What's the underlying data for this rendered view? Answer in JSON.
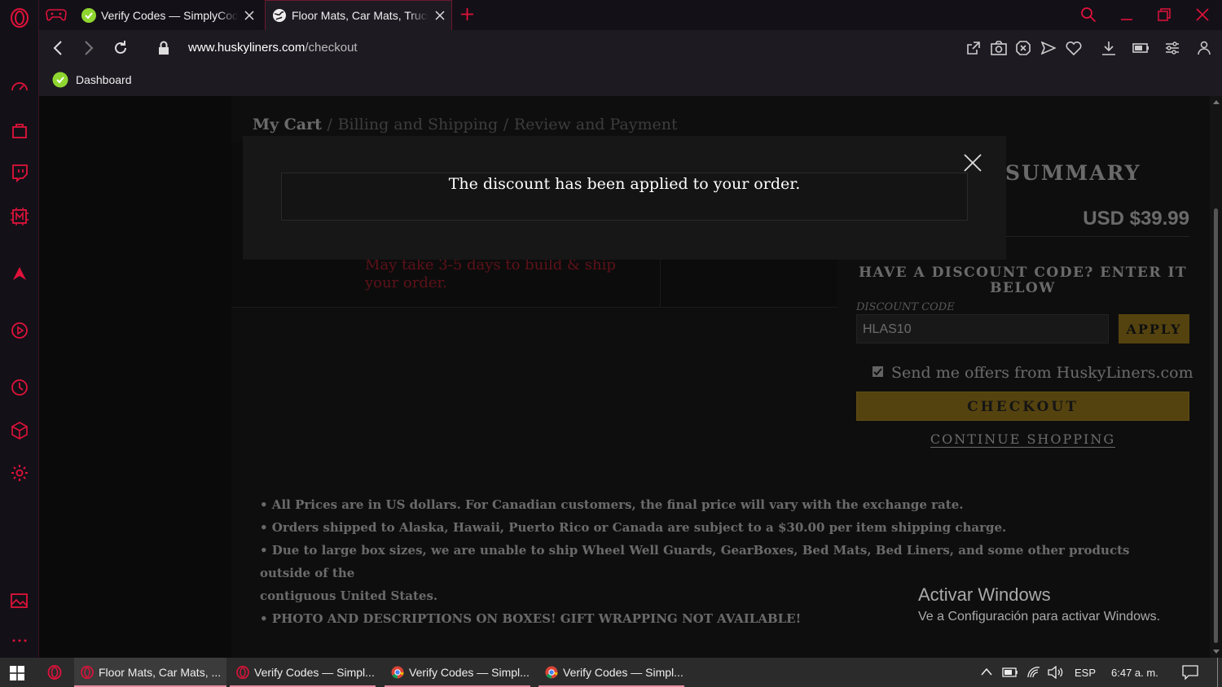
{
  "browser": {
    "tabs": [
      {
        "title": "Verify Codes — SimplyCodes",
        "active": false
      },
      {
        "title": "Floor Mats, Car Mats, Truck",
        "active": true
      }
    ],
    "url_domain": "www.huskyliners.com",
    "url_path": "/checkout",
    "bookmark": "Dashboard"
  },
  "checkout": {
    "breadcrumb": {
      "current": "My Cart",
      "sep1": "/",
      "step2": "Billing and Shipping",
      "sep2": "/",
      "step3": "Review and Payment"
    },
    "summary_title": "SUMMARY",
    "total": "USD $39.99",
    "shipping_note": "May take 3-5 days to build & ship your order.",
    "discount_heading": "HAVE A DISCOUNT CODE? ENTER IT BELOW",
    "discount_label": "DISCOUNT CODE",
    "discount_value": "HLAS10",
    "apply_label": "APPLY",
    "offers_label": "Send me offers from HuskyLiners.com",
    "checkout_label": "CHECKOUT",
    "continue_label": "CONTINUE SHOPPING",
    "notes": [
      "• All Prices are in US dollars. For Canadian customers, the final price will vary with the exchange rate.",
      "• Orders shipped to Alaska, Hawaii, Puerto Rico or Canada are subject to a $30.00 per item shipping charge.",
      "• Due to large box sizes, we are unable to ship Wheel Well Guards, GearBoxes, Bed Mats, Bed Liners, and some other products outside of the",
      "contiguous United States.",
      "• PHOTO AND DESCRIPTIONS ON BOXES! GIFT WRAPPING NOT AVAILABLE!"
    ]
  },
  "modal": {
    "message": "The discount has been applied to your order."
  },
  "windows_watermark": {
    "title": "Activar Windows",
    "subtitle": "Ve a Configuración para activar Windows."
  },
  "taskbar": {
    "items": [
      {
        "label": "Floor Mats, Car Mats, ...",
        "icon": "opera-icon"
      },
      {
        "label": "Verify Codes — Simpl...",
        "icon": "opera-icon"
      },
      {
        "label": "Verify Codes — Simpl...",
        "icon": "chrome-icon"
      },
      {
        "label": "Verify Codes — Simpl...",
        "icon": "chrome-icon"
      }
    ],
    "language": "ESP",
    "time": "6:47 a. m."
  },
  "colors": {
    "accent": "#e0123a",
    "gold": "#c99a12",
    "red_note": "#c0182a"
  }
}
